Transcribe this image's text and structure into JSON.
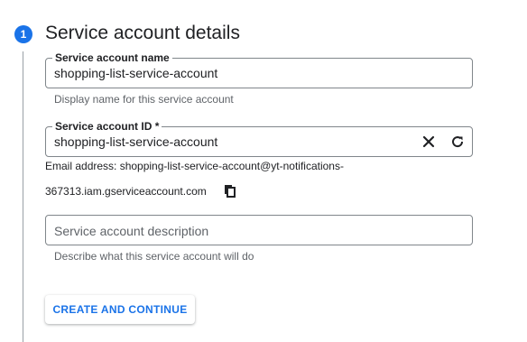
{
  "step": {
    "number": "1",
    "title": "Service account details"
  },
  "name_field": {
    "label": "Service account name",
    "value": "shopping-list-service-account",
    "hint": "Display name for this service account"
  },
  "id_field": {
    "label": "Service account ID *",
    "value": "shopping-list-service-account",
    "clear_icon": "close-icon",
    "refresh_icon": "refresh-icon"
  },
  "email": {
    "line1": "Email address: shopping-list-service-account@yt-notifications-",
    "line2": "367313.iam.gserviceaccount.com",
    "copy_icon": "copy-icon"
  },
  "description_field": {
    "placeholder": "Service account description",
    "value": "",
    "hint": "Describe what this service account will do"
  },
  "actions": {
    "create_label": "CREATE AND CONTINUE"
  },
  "colors": {
    "accent": "#1a73e8",
    "border": "#80868b",
    "hint": "#5f6368"
  }
}
